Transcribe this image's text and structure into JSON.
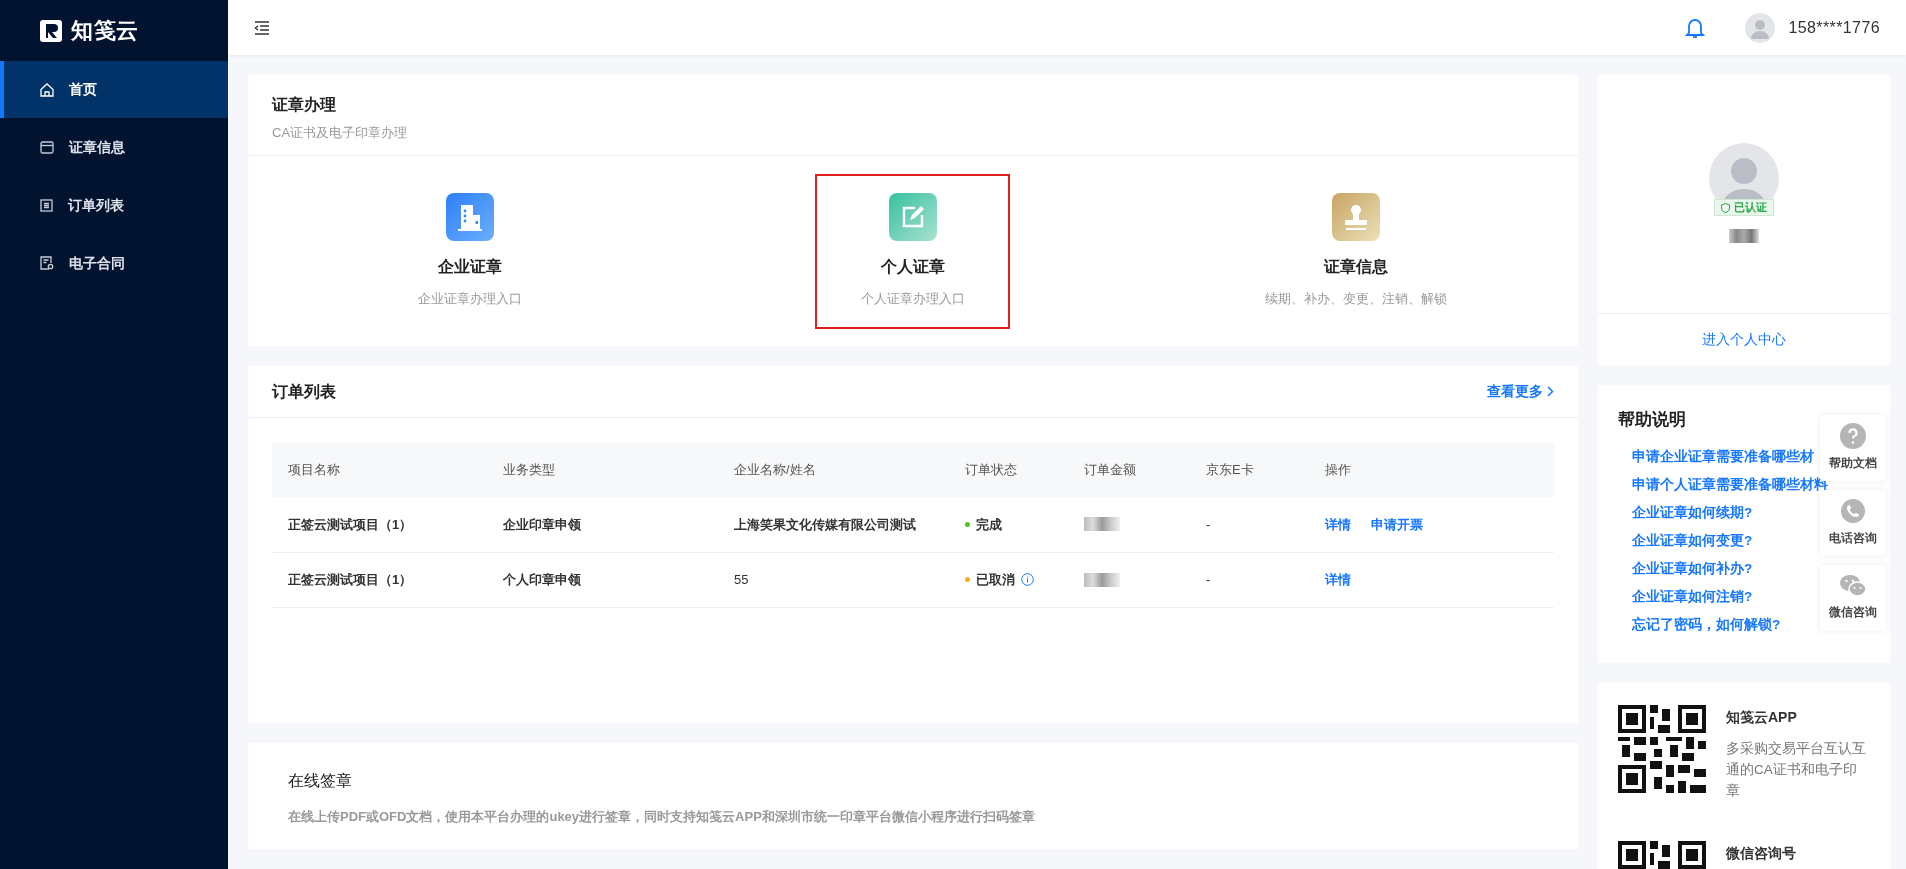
{
  "sidebar": {
    "logo_text": "知笺云",
    "items": [
      {
        "label": "首页",
        "kind": "home",
        "selected": true
      },
      {
        "label": "证章信息",
        "kind": "card",
        "selected": false
      },
      {
        "label": "订单列表",
        "kind": "list",
        "selected": false
      },
      {
        "label": "电子合同",
        "kind": "contract",
        "selected": false
      }
    ]
  },
  "header": {
    "user_phone": "158****1776"
  },
  "certificate_card": {
    "title": "证章办理",
    "subtitle": "CA证书及电子印章办理",
    "entries": [
      {
        "kind": "enterprise",
        "title": "企业证章",
        "description": "企业证章办理入口",
        "highlighted": false
      },
      {
        "kind": "personal",
        "title": "个人证章",
        "description": "个人证章办理入口",
        "highlighted": true
      },
      {
        "kind": "info",
        "title": "证章信息",
        "description": "续期、补办、变更、注销、解锁",
        "highlighted": false
      }
    ]
  },
  "orders": {
    "title": "订单列表",
    "more_link": "查看更多",
    "columns": [
      "项目名称",
      "业务类型",
      "企业名称/姓名",
      "订单状态",
      "订单金额",
      "京东E卡",
      "操作"
    ],
    "rows": [
      {
        "project": "正签云测试项目（1）",
        "type": "企业印章申领",
        "name": "上海笑果文化传媒有限公司测试",
        "name_bold": true,
        "status": "完成",
        "color": "#52c41a",
        "info": false,
        "jd_card": "-",
        "actions": [
          "详情",
          "申请开票"
        ]
      },
      {
        "project": "正签云测试项目（1）",
        "type": "个人印章申领",
        "name": "55",
        "name_bold": false,
        "status": "已取消",
        "color": "#faad14",
        "info": true,
        "jd_card": "-",
        "actions": [
          "详情"
        ]
      }
    ]
  },
  "online_signing": {
    "title": "在线签章",
    "description": "在线上传PDF或OFD文档，使用本平台办理的ukey进行签章，同时支持知笺云APP和深圳市统一印章平台微信小程序进行扫码签章"
  },
  "profile": {
    "verified_badge": "已认证",
    "link": "进入个人中心"
  },
  "help": {
    "title": "帮助说明",
    "links": [
      "申请企业证章需要准备哪些材",
      "申请个人证章需要准备哪些材料",
      "企业证章如何续期?",
      "企业证章如何变更?",
      "企业证章如何补办?",
      "企业证章如何注销?",
      "忘记了密码，如何解锁?"
    ]
  },
  "float_buttons": [
    {
      "kind": "help",
      "label": "帮助文档"
    },
    {
      "kind": "phone",
      "label": "电话咨询"
    },
    {
      "kind": "wechat",
      "label": "微信咨询"
    }
  ],
  "apps": [
    {
      "title": "知笺云APP",
      "description": "多采购交易平台互认互通的CA证书和电子印章"
    },
    {
      "title": "微信咨询号"
    }
  ]
}
